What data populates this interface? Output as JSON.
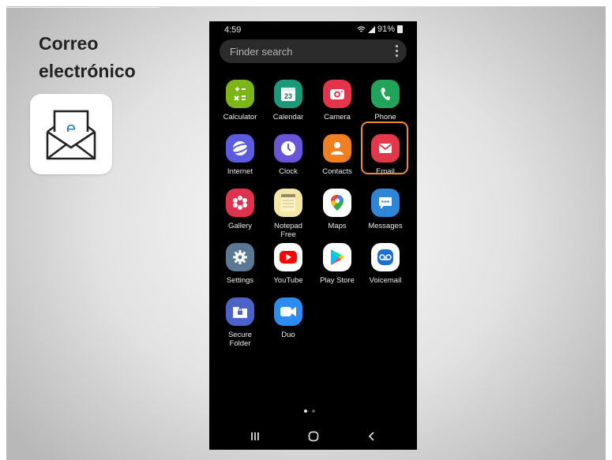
{
  "slide": {
    "title": "Correo\nelectrónico",
    "app_icon_letter": "e"
  },
  "status_bar": {
    "time": "4:59",
    "battery": "91%"
  },
  "search": {
    "placeholder": "Finder search"
  },
  "apps": [
    {
      "name": "Calculator",
      "icon": "calculator-icon",
      "color": "#7cb518"
    },
    {
      "name": "Calendar",
      "icon": "calendar-icon",
      "color": "#1a9a7a"
    },
    {
      "name": "Camera",
      "icon": "camera-icon",
      "color": "#e5334b"
    },
    {
      "name": "Phone",
      "icon": "phone-icon",
      "color": "#21a35a"
    },
    {
      "name": "Internet",
      "icon": "internet-icon",
      "color": "#5b5be0"
    },
    {
      "name": "Clock",
      "icon": "clock-icon",
      "color": "#6a55d8"
    },
    {
      "name": "Contacts",
      "icon": "contacts-icon",
      "color": "#f07f22"
    },
    {
      "name": "Email",
      "icon": "email-icon",
      "color": "#e2384a"
    },
    {
      "name": "Gallery",
      "icon": "gallery-icon",
      "color": "#e0314f"
    },
    {
      "name": "Notepad\nFree",
      "icon": "notepad-icon",
      "color": "#f3e7a6"
    },
    {
      "name": "Maps",
      "icon": "maps-icon",
      "color": "#ffffff"
    },
    {
      "name": "Messages",
      "icon": "messages-icon",
      "color": "#2f86d8"
    },
    {
      "name": "Settings",
      "icon": "settings-icon",
      "color": "#5a7894"
    },
    {
      "name": "YouTube",
      "icon": "youtube-icon",
      "color": "#ffffff"
    },
    {
      "name": "Play Store",
      "icon": "play-store-icon",
      "color": "#ffffff"
    },
    {
      "name": "Voicemail",
      "icon": "voicemail-icon",
      "color": "#ffffff"
    },
    {
      "name": "Secure\nFolder",
      "icon": "secure-folder-icon",
      "color": "#4b62c8"
    },
    {
      "name": "Duo",
      "icon": "duo-icon",
      "color": "#2d8cf0"
    }
  ],
  "highlighted_app": "Email",
  "accent_color": "#f28a2e",
  "page_indicator": {
    "current": 1,
    "total": 2
  }
}
